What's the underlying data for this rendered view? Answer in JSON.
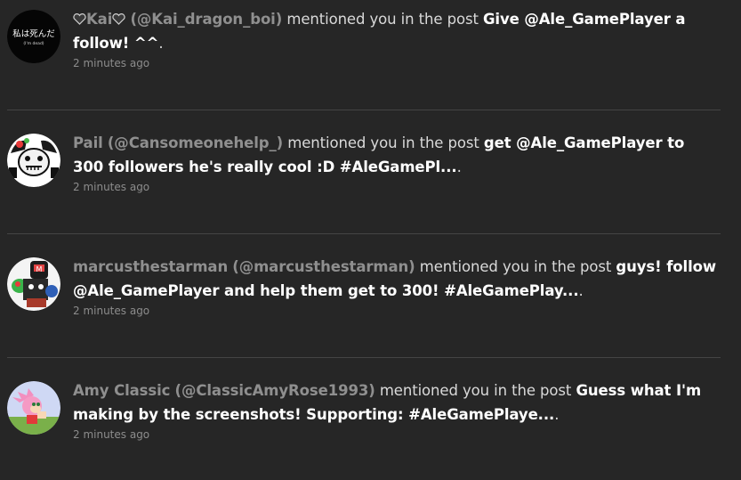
{
  "notifications": [
    {
      "user": "Kai",
      "handle": "(@Kai_dragon_boi)",
      "verb": "mentioned you in the post",
      "post": "Give @Ale_GamePlayer a follow! ^^",
      "tail": ".",
      "time": "2 minutes ago",
      "avatar": {
        "icon": "black-circle-japanese-text-avatar",
        "text": "私は死んだ",
        "subtext": "(I'm dead)"
      }
    },
    {
      "user": "Pail",
      "handle": "(@Cansomeonehelp_)",
      "verb": "mentioned you in the post",
      "post": "get @Ale_GamePlayer to 300 followers he's really cool :D #AleGamePl...",
      "tail": ".",
      "time": "2 minutes ago",
      "avatar": {
        "icon": "cartoon-face-avatar"
      }
    },
    {
      "user": "marcusthestarman",
      "handle": "(@marcusthestarman)",
      "verb": "mentioned you in the post",
      "post": "guys! follow @Ale_GamePlayer and help them get to 300! #AleGamePlay...",
      "tail": ".",
      "time": "2 minutes ago",
      "avatar": {
        "icon": "pixel-character-avatar"
      }
    },
    {
      "user": "Amy Classic",
      "handle": "(@ClassicAmyRose1993)",
      "verb": "mentioned you in the post",
      "post": "Guess what I'm making by the screenshots! Supporting: #AleGamePlaye...",
      "tail": ".",
      "time": "2 minutes ago",
      "avatar": {
        "icon": "pink-hedgehog-avatar"
      }
    }
  ],
  "colors": {
    "background": "#262626",
    "username": "#8f8f8f",
    "post_title": "#ffffff",
    "timestamp": "#8c8c8c",
    "divider": "#444444"
  }
}
